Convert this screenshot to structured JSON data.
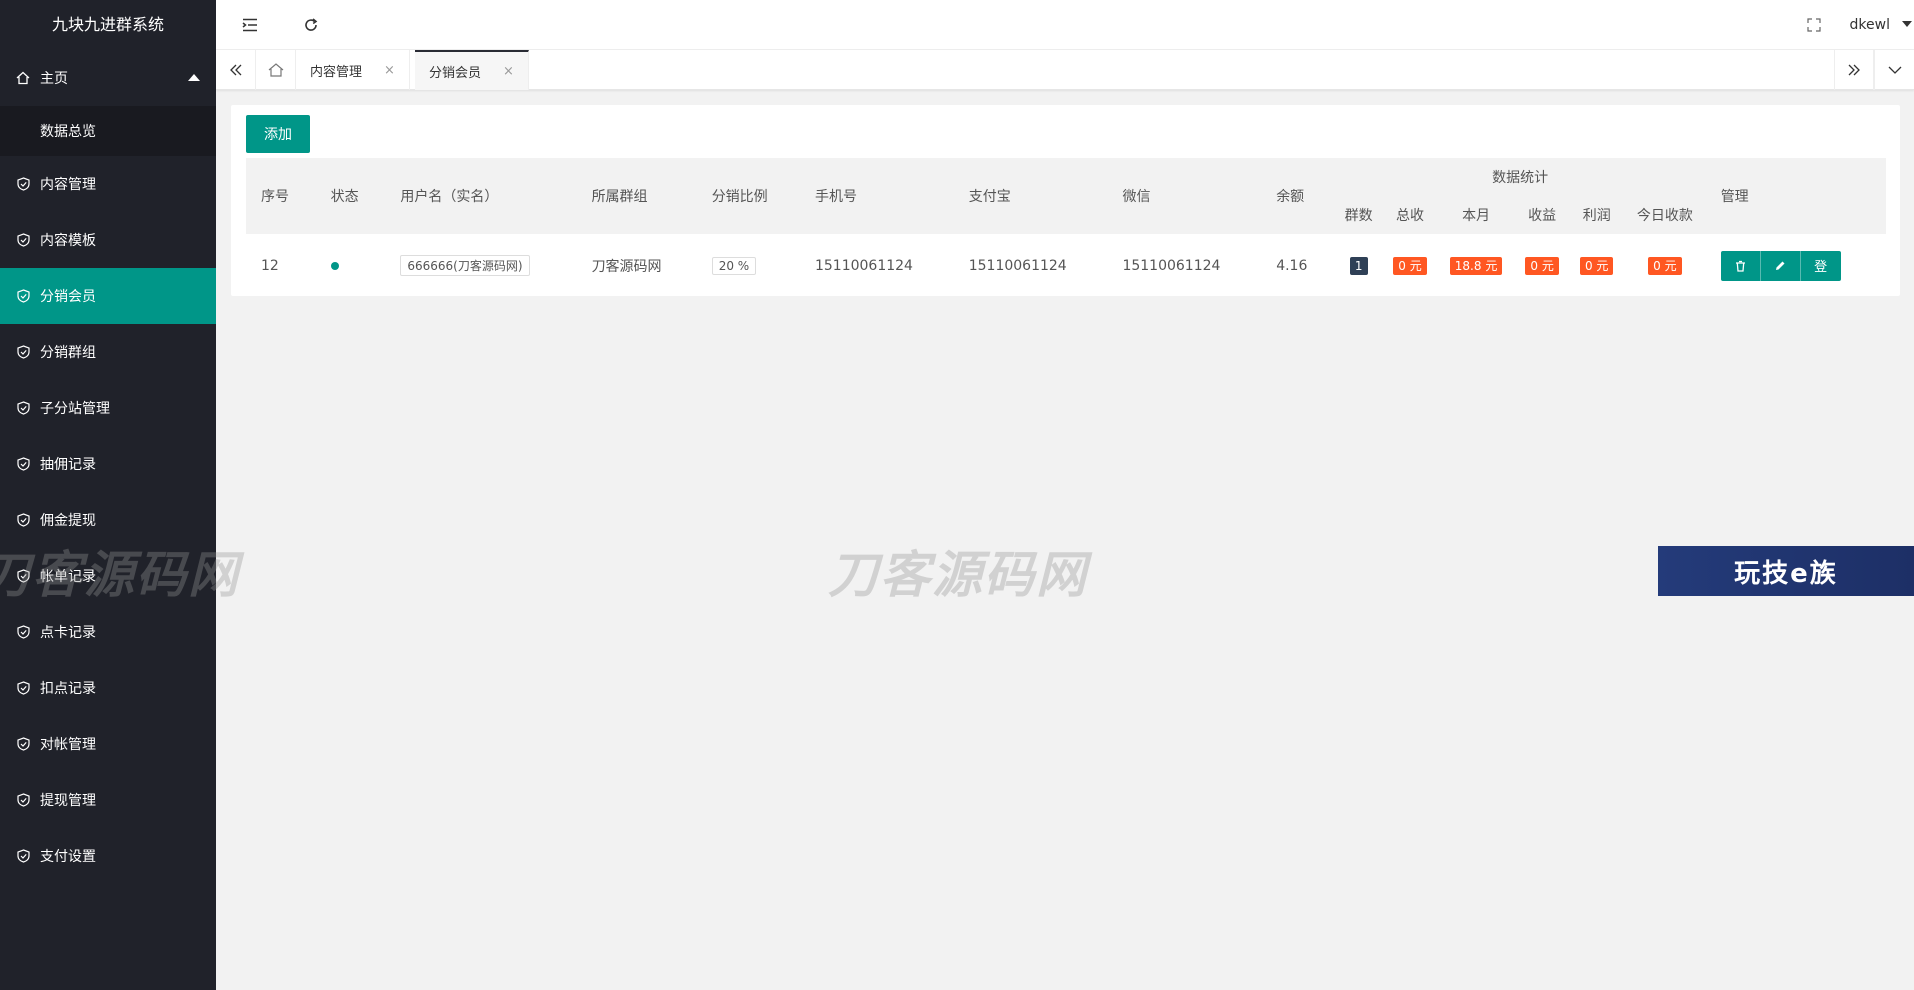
{
  "app": {
    "title": "九块九进群系统"
  },
  "sidebar": {
    "home": {
      "label": "主页",
      "icon": "home-icon"
    },
    "home_sub": [
      {
        "label": "数据总览"
      }
    ],
    "items": [
      {
        "label": "内容管理"
      },
      {
        "label": "内容模板"
      },
      {
        "label": "分销会员"
      },
      {
        "label": "分销群组"
      },
      {
        "label": "子分站管理"
      },
      {
        "label": "抽佣记录"
      },
      {
        "label": "佣金提现"
      },
      {
        "label": "帐单记录"
      },
      {
        "label": "点卡记录"
      },
      {
        "label": "扣点记录"
      },
      {
        "label": "对帐管理"
      },
      {
        "label": "提现管理"
      },
      {
        "label": "支付设置"
      }
    ],
    "active_index": 2
  },
  "header": {
    "user": "dkewl"
  },
  "tabs": [
    {
      "label": "内容管理",
      "close": "×"
    },
    {
      "label": "分销会员",
      "close": "×"
    }
  ],
  "main": {
    "add_label": "添加",
    "group_header": "数据统计",
    "columns": {
      "id": "序号",
      "status": "状态",
      "username": "用户名（实名）",
      "group": "所属群组",
      "ratio": "分销比例",
      "phone": "手机号",
      "alipay": "支付宝",
      "wechat": "微信",
      "balance": "余额",
      "groups": "群数",
      "total": "总收",
      "month": "本月",
      "income": "收益",
      "profit": "利润",
      "today": "今日收款",
      "manage": "管理"
    },
    "rows": [
      {
        "id": "12",
        "username": "666666(刀客源码网)",
        "group": "刀客源码网",
        "ratio": "20 %",
        "phone": "15110061124",
        "alipay": "15110061124",
        "wechat": "15110061124",
        "balance": "4.16",
        "groups": "1",
        "total": "0 元",
        "month": "18.8 元",
        "income": "0 元",
        "profit": "0 元",
        "today": "0 元",
        "login_label": "登"
      }
    ]
  },
  "watermarks": {
    "text1": "刀客源码网",
    "text2": "刀客源码网",
    "banner": "玩技e族"
  },
  "colors": {
    "accent": "#009688",
    "sidebar": "#20222a",
    "badge": "#ff5722"
  }
}
